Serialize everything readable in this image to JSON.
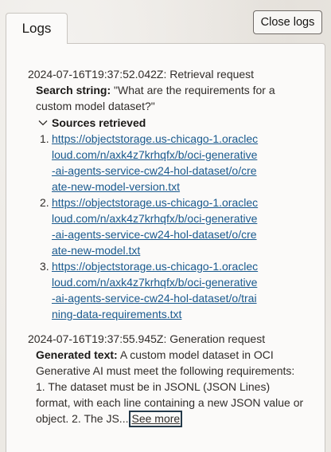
{
  "tabs": {
    "logs_label": "Logs"
  },
  "toolbar": {
    "close_label": "Close logs"
  },
  "log_entries": [
    {
      "timestamp_header": "2024-07-16T19:37:52.042Z: Retrieval request",
      "search_label": "Search string:",
      "search_value": " \"What are the requirements for a custom model dataset?\"",
      "sources_label": "Sources retrieved",
      "sources": [
        {
          "num": "1.",
          "url": "https://objectstorage.us-chicago-1.oraclecloud.com/n/axk4z7krhqfx/b/oci-generative-ai-agents-service-cw24-hol-dataset/o/create-new-model-version.txt"
        },
        {
          "num": "2.",
          "url": "https://objectstorage.us-chicago-1.oraclecloud.com/n/axk4z7krhqfx/b/oci-generative-ai-agents-service-cw24-hol-dataset/o/create-new-model.txt"
        },
        {
          "num": "3.",
          "url": "https://objectstorage.us-chicago-1.oraclecloud.com/n/axk4z7krhqfx/b/oci-generative-ai-agents-service-cw24-hol-dataset/o/training-data-requirements.txt"
        }
      ]
    },
    {
      "timestamp_header": "2024-07-16T19:37:55.945Z: Generation request",
      "generated_label": "Generated text:",
      "generated_value": " A custom model dataset in OCI Generative AI must meet the following requirements: 1. The dataset must be in JSONL (JSON Lines) format, with each line containing a new JSON value or object. 2. The JS...",
      "see_more_label": "See more"
    }
  ],
  "icons": {
    "toggle": "chevron-down-icon"
  }
}
